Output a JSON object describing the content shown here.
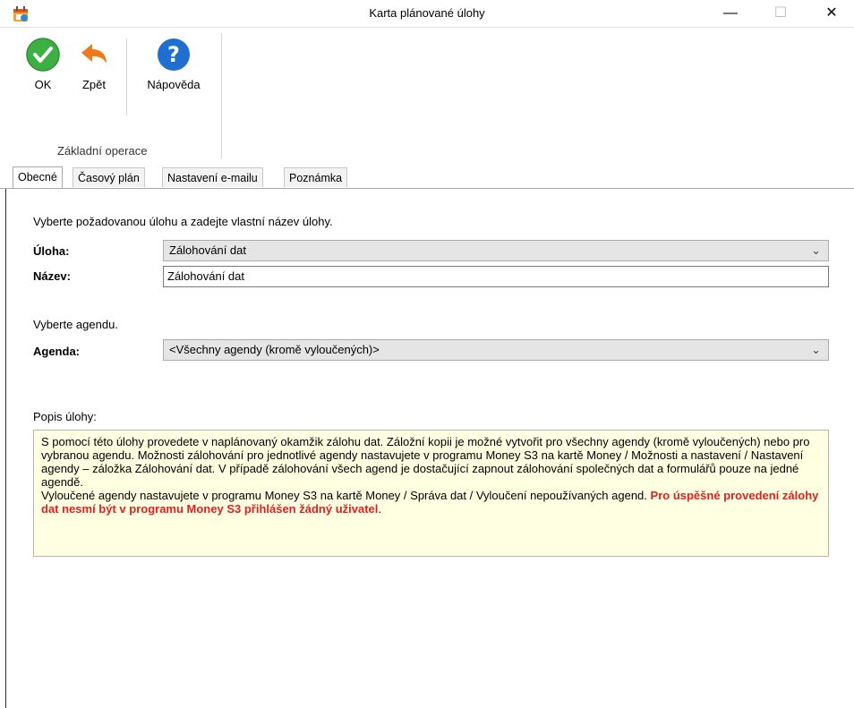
{
  "window": {
    "title": "Karta plánované úlohy",
    "app_icon": "calendar-app-icon",
    "minimize_glyph": "—",
    "maximize_glyph": "☐",
    "close_glyph": "✕"
  },
  "ribbon": {
    "buttons": [
      {
        "label": "OK",
        "icon": "ok-check-icon",
        "color": "#3cb043"
      },
      {
        "label": "Zpět",
        "icon": "undo-arrow-icon",
        "color": "#f07a1a"
      },
      {
        "label": "Nápověda",
        "icon": "help-question-icon",
        "color": "#1e6fd0"
      }
    ],
    "group_label": "Základní operace"
  },
  "tabs": [
    {
      "label": "Obecné",
      "active": true
    },
    {
      "label": "Časový plán",
      "active": false
    },
    {
      "label": "Nastavení e-mailu",
      "active": false
    },
    {
      "label": "Poznámka",
      "active": false
    }
  ],
  "form": {
    "intro": "Vyberte požadovanou úlohu a zadejte vlastní název úlohy.",
    "task_label": "Úloha:",
    "task_value": "Zálohování dat",
    "name_label": "Název:",
    "name_value": "Zálohování dat",
    "agenda_intro": "Vyberte agendu.",
    "agenda_label": "Agenda:",
    "agenda_value": "<Všechny agendy (kromě vyloučených)>",
    "description_label": "Popis úlohy:",
    "description_text": "S pomocí této úlohy provedete v naplánovaný okamžik zálohu dat. Záložní kopii je možné vytvořit pro všechny agendy (kromě vyloučených) nebo pro vybranou agendu. Možnosti zálohování pro jednotlivé agendy nastavujete v programu Money S3 na kartě Money / Možnosti a nastavení / Nastavení agendy – záložka Zálohování dat. V případě zálohování všech agend je dostačující zapnout zálohování společných dat a formulářů pouze na jedné agendě.",
    "description_text2": "Vyloučené agendy nastavujete v programu Money S3 na kartě Money / Správa dat / Vyloučení nepoužívaných agend.",
    "description_warning": "Pro úspěšné provedení zálohy dat nesmí být v programu Money S3 přihlášen žádný uživatel",
    "description_end": "."
  }
}
